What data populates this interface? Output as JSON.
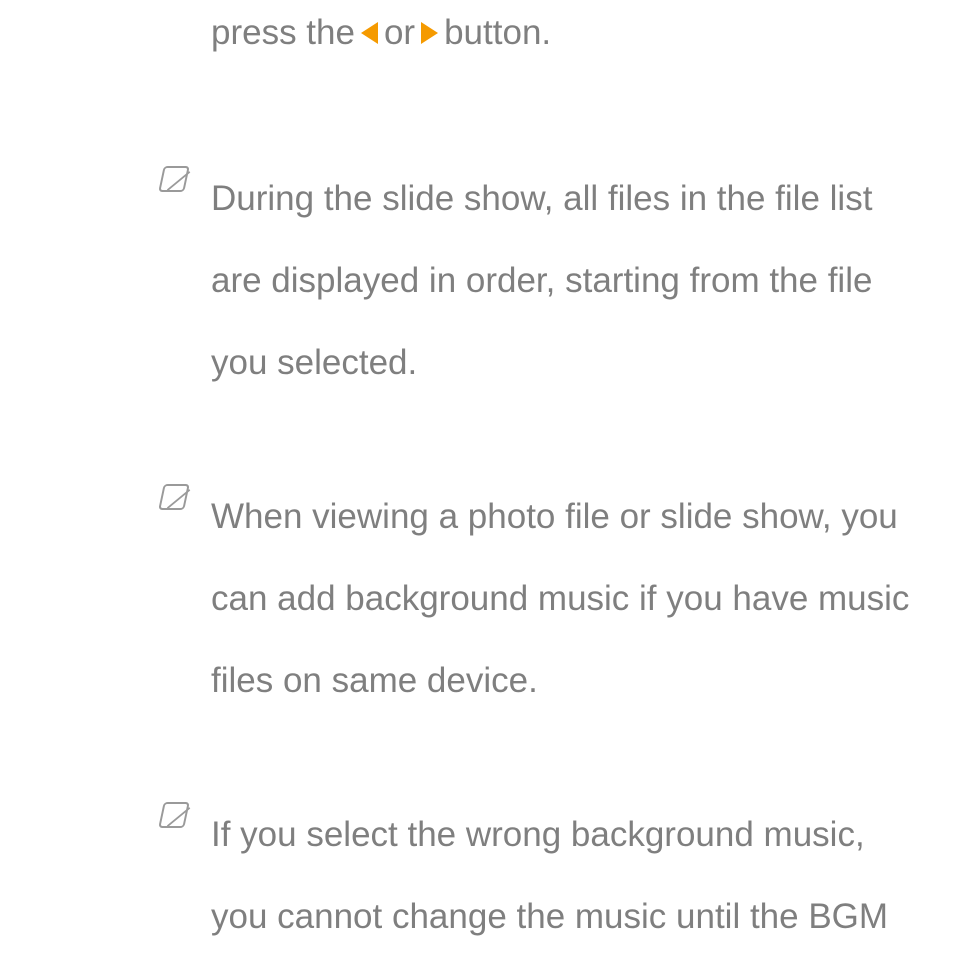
{
  "top_line": {
    "prefix": "press the ",
    "mid": " or ",
    "suffix": " button."
  },
  "notes": [
    "During the slide show, all files in the file list are displayed in order, starting from the file you selected.",
    "When viewing a photo file or slide show, you can add background music if you have music files on same device.",
    "If you select the wrong background music, you cannot change the music until the BGM"
  ]
}
